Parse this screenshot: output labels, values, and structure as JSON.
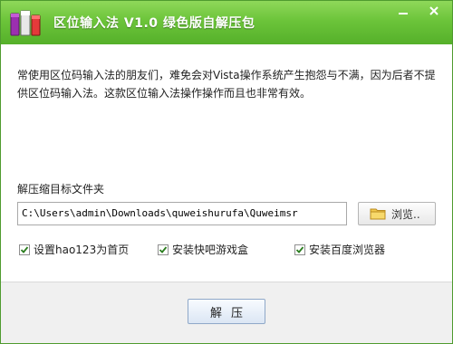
{
  "window": {
    "title": "区位输入法 V1.0 绿色版自解压包",
    "icons": {
      "app": "books-icon",
      "minimize": "minimize-icon",
      "close": "close-icon"
    },
    "colors": {
      "titlebar": "#6cc43a",
      "border": "#4f9b2f",
      "footer": "#f0f0f0"
    }
  },
  "content": {
    "description": "常使用区位码输入法的朋友们，难免会对Vista操作系统产生抱怨与不满，因为后者不提供区位码输入法。这款区位输入法操作操作而且也非常有效。",
    "folder_label": "解压缩目标文件夹",
    "path_value": "C:\\Users\\admin\\Downloads\\quweishurufa\\Quweimsr",
    "browse_label": "浏览..",
    "browse_icon": "folder-icon",
    "checkboxes": [
      {
        "label": "设置hao123为首页",
        "checked": true
      },
      {
        "label": "安装快吧游戏盒",
        "checked": true
      },
      {
        "label": "安装百度浏览器",
        "checked": true
      }
    ]
  },
  "footer": {
    "extract_label": "解压"
  }
}
